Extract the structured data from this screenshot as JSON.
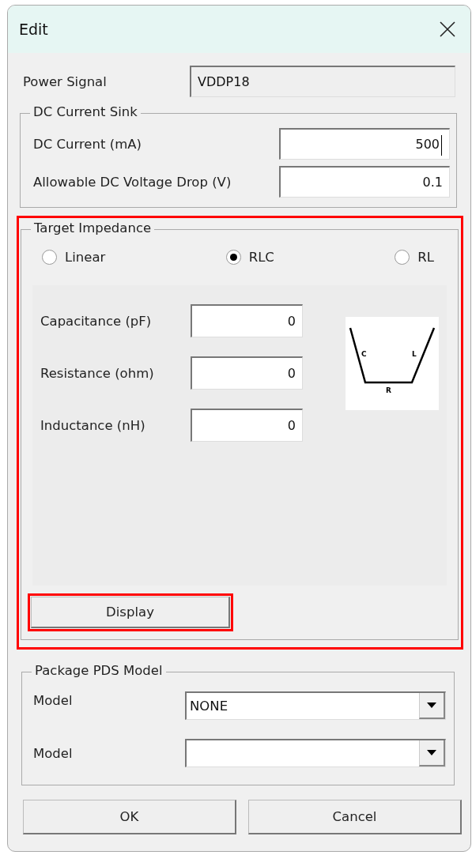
{
  "window": {
    "title": "Edit"
  },
  "power_signal": {
    "label": "Power Signal",
    "value": "VDDP18",
    "disabled": true
  },
  "dc_current_sink": {
    "title": "DC Current Sink",
    "fields": [
      {
        "label": "DC Current (mA)",
        "value": "500",
        "focused": true
      },
      {
        "label": "Allowable DC Voltage Drop (V)",
        "value": "0.1",
        "focused": false
      }
    ]
  },
  "target_impedance": {
    "title": "Target Impedance",
    "highlighted": true,
    "options": [
      {
        "label": "Linear",
        "selected": false
      },
      {
        "label": "RLC",
        "selected": true
      },
      {
        "label": "RL",
        "selected": false
      }
    ],
    "fields": [
      {
        "label": "Capacitance (pF)",
        "value": "0"
      },
      {
        "label": "Resistance (ohm)",
        "value": "0"
      },
      {
        "label": "Inductance (nH)",
        "value": "0"
      }
    ],
    "diagram_labels": [
      "C",
      "L",
      "R"
    ],
    "display_button": {
      "label": "Display",
      "highlighted": true
    }
  },
  "package_pds_model": {
    "title": "Package PDS Model",
    "rows": [
      {
        "label": "Model",
        "value": "NONE"
      },
      {
        "label": "Model"
      }
    ]
  },
  "buttons": [
    "OK",
    "Cancel"
  ]
}
